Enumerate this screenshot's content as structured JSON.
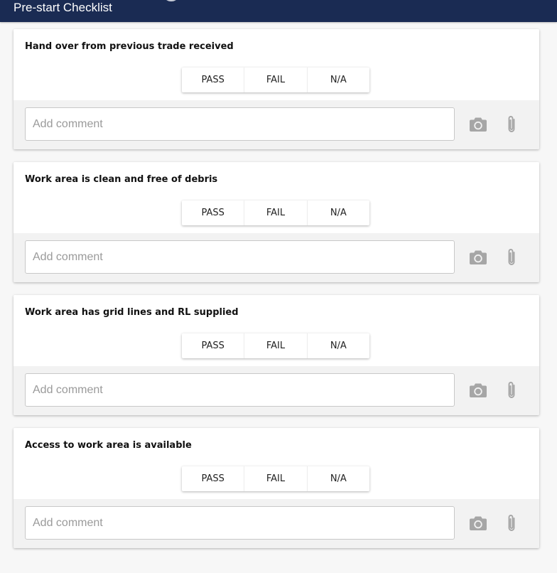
{
  "header": {
    "title": "Pre-start Checklist"
  },
  "checklist": [
    {
      "question": "Hand over from previous trade received",
      "options": [
        "PASS",
        "FAIL",
        "N/A"
      ],
      "comment_placeholder": "Add comment",
      "comment_value": ""
    },
    {
      "question": "Work area is clean and free of debris",
      "options": [
        "PASS",
        "FAIL",
        "N/A"
      ],
      "comment_placeholder": "Add comment",
      "comment_value": ""
    },
    {
      "question": "Work area has grid lines and RL supplied",
      "options": [
        "PASS",
        "FAIL",
        "N/A"
      ],
      "comment_placeholder": "Add comment",
      "comment_value": ""
    },
    {
      "question": "Access to work area is available",
      "options": [
        "PASS",
        "FAIL",
        "N/A"
      ],
      "comment_placeholder": "Add comment",
      "comment_value": ""
    }
  ],
  "icons": {
    "camera": "camera-icon",
    "attach": "paperclip-icon"
  },
  "colors": {
    "header_bg": "#1a2b53",
    "header_text": "#ffffff",
    "icon_gray": "#a6a6a6",
    "card_footer_bg": "#f2f2f2"
  }
}
